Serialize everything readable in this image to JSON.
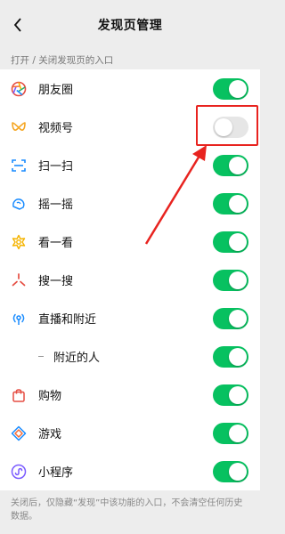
{
  "header": {
    "title": "发现页管理",
    "back_icon": "chevron-left-icon"
  },
  "section": {
    "label": "打开 / 关闭发现页的入口"
  },
  "items": [
    {
      "label": "朋友圈",
      "icon": "moments-icon",
      "enabled": true
    },
    {
      "label": "视频号",
      "icon": "channels-icon",
      "enabled": false
    },
    {
      "label": "扫一扫",
      "icon": "scan-icon",
      "enabled": true
    },
    {
      "label": "摇一摇",
      "icon": "shake-icon",
      "enabled": true
    },
    {
      "label": "看一看",
      "icon": "top-stories-icon",
      "enabled": true
    },
    {
      "label": "搜一搜",
      "icon": "search-icon",
      "enabled": true
    },
    {
      "label": "直播和附近",
      "icon": "live-nearby-icon",
      "enabled": true
    },
    {
      "label": "附近的人",
      "icon": "",
      "enabled": true,
      "sub": true
    },
    {
      "label": "购物",
      "icon": "shopping-icon",
      "enabled": true
    },
    {
      "label": "游戏",
      "icon": "games-icon",
      "enabled": true
    },
    {
      "label": "小程序",
      "icon": "mini-programs-icon",
      "enabled": true
    }
  ],
  "footer": {
    "note": "关闭后，仅隐藏“发现”中该功能的入口，不会清空任何历史数据。"
  },
  "colors": {
    "toggle_on": "#07c160",
    "toggle_off": "#e6e6e6",
    "annotation": "#e8231f"
  }
}
